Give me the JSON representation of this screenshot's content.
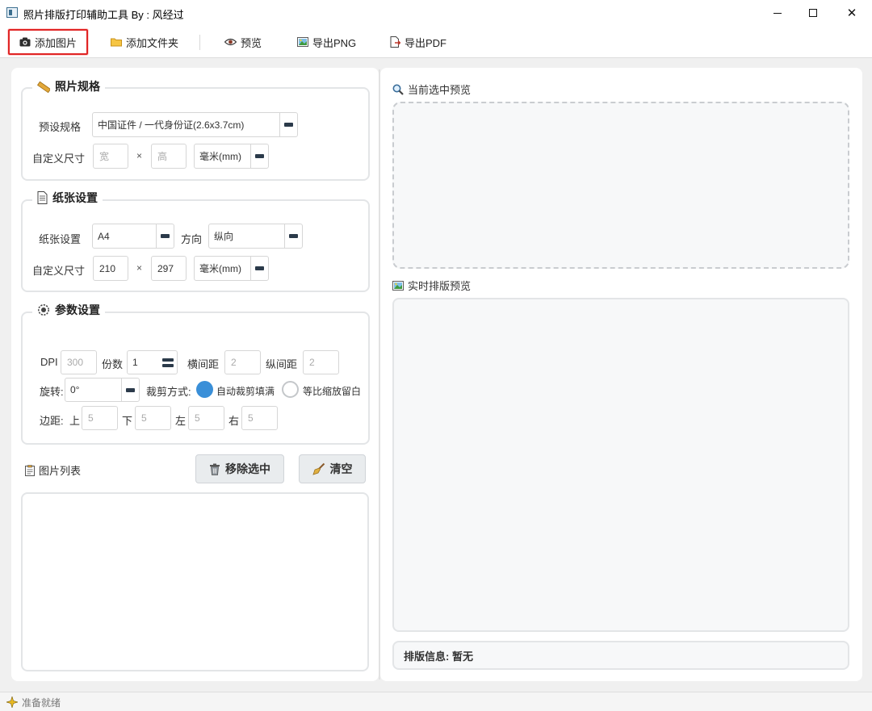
{
  "window": {
    "title": "照片排版打印辅助工具 By : 风经过"
  },
  "toolbar": {
    "add_image": "添加图片",
    "add_folder": "添加文件夹",
    "preview": "预览",
    "export_png": "导出PNG",
    "export_pdf": "导出PDF"
  },
  "photo_spec": {
    "title": "照片规格",
    "preset_label": "预设规格",
    "preset_value": "中国证件 / 一代身份证(2.6x3.7cm)",
    "custom_label": "自定义尺寸",
    "width_placeholder": "宽",
    "times": "×",
    "height_placeholder": "高",
    "unit": "毫米(mm)"
  },
  "paper": {
    "title": "纸张设置",
    "paper_label": "纸张设置",
    "paper_value": "A4",
    "orientation_label": "方向",
    "orientation_value": "纵向",
    "custom_label": "自定义尺寸",
    "width": "210",
    "times": "×",
    "height": "297",
    "unit": "毫米(mm)"
  },
  "params": {
    "title": "参数设置",
    "dpi_label": "DPI",
    "dpi_value": "300",
    "copies_label": "份数",
    "copies_value": "1",
    "h_spacing_label": "横间距",
    "h_spacing_value": "2",
    "v_spacing_label": "纵间距",
    "v_spacing_value": "2",
    "rotate_label": "旋转:",
    "rotate_value": "0°",
    "crop_label": "裁剪方式:",
    "crop_option_fill": "自动裁剪填满",
    "crop_option_fit": "等比缩放留白",
    "crop_selected": "fill",
    "margin_label": "边距:",
    "margin_top_label": "上",
    "margin_top": "5",
    "margin_bottom_label": "下",
    "margin_bottom": "5",
    "margin_left_label": "左",
    "margin_left": "5",
    "margin_right_label": "右",
    "margin_right": "5"
  },
  "image_list": {
    "title": "图片列表",
    "remove_selected": "移除选中",
    "clear": "清空"
  },
  "right": {
    "current_preview_label": "当前选中预览",
    "live_preview_label": "实时排版预览",
    "layout_info": "排版信息: 暂无"
  },
  "status": {
    "text": "准备就绪"
  },
  "colors": {
    "highlight_border": "#e02424",
    "radio_selected": "#3a8fd8",
    "group_border": "#e3e5e7"
  }
}
